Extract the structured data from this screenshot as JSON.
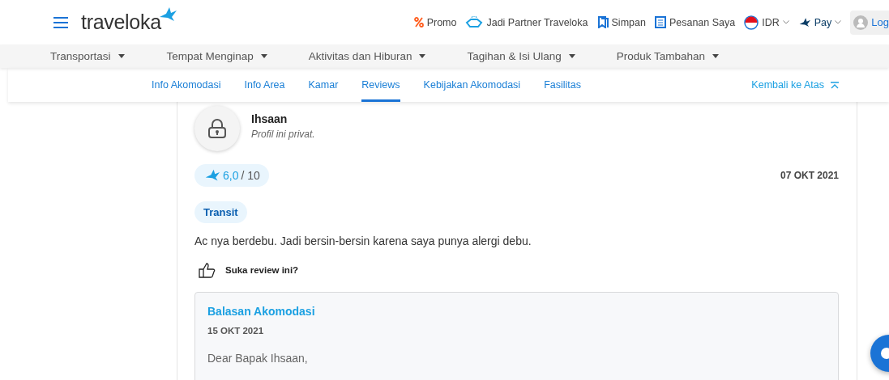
{
  "header": {
    "logo": "traveloka",
    "links": [
      {
        "kind": "promo",
        "label": "Promo"
      },
      {
        "kind": "partner",
        "label": "Jadi Partner Traveloka"
      },
      {
        "kind": "save",
        "label": "Simpan"
      },
      {
        "kind": "orders",
        "label": "Pesanan Saya"
      },
      {
        "kind": "currency",
        "label": "IDR"
      },
      {
        "kind": "pay",
        "label": "Pay"
      }
    ],
    "login": "Log"
  },
  "categories": [
    "Transportasi",
    "Tempat Menginap",
    "Aktivitas dan Hiburan",
    "Tagihan & Isi Ulang",
    "Produk Tambahan"
  ],
  "subnav": {
    "tabs": [
      {
        "label": "Info Akomodasi",
        "selected": false
      },
      {
        "label": "Info Area",
        "selected": false
      },
      {
        "label": "Kamar",
        "selected": false
      },
      {
        "label": "Reviews",
        "selected": true
      },
      {
        "label": "Kebijakan Akomodasi",
        "selected": false
      },
      {
        "label": "Fasilitas",
        "selected": false
      }
    ],
    "back_to_top": "Kembali ke Atas"
  },
  "review": {
    "name": "Ihsaan",
    "profile_note": "Profil ini privat.",
    "score": "6,0",
    "scale": "/ 10",
    "date": "07 OKT 2021",
    "tag": "Transit",
    "text": "Ac nya berdebu. Jadi bersin-bersin karena saya punya alergi debu.",
    "like": "Suka review ini?",
    "reply": {
      "title": "Balasan Akomodasi",
      "date": "15 OKT 2021",
      "text": "Dear Bapak Ihsaan,"
    }
  }
}
